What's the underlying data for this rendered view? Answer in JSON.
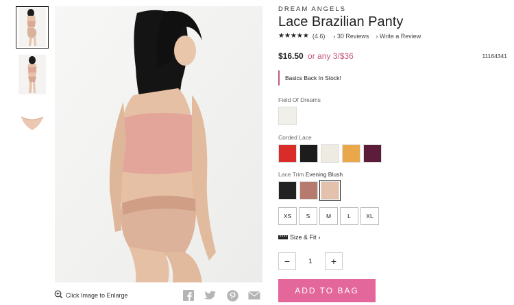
{
  "product": {
    "brand": "DREAM ANGELS",
    "title": "Lace Brazilian Panty",
    "stars": "★★★★★",
    "rating_count": "(4.6)",
    "reviews_link": "30 Reviews",
    "write_review": "Write a Review",
    "price": "$16.50",
    "promo": "or any 3/$36",
    "sku": "11164341",
    "notice": "Basics Back In Stock!"
  },
  "swatch_groups": [
    {
      "label": "Field Of Dreams",
      "selected_name": "",
      "colors": [
        "#f1efe9"
      ]
    },
    {
      "label": "Corded Lace",
      "selected_name": "",
      "colors": [
        "#d92b27",
        "#1c1c1c",
        "#eeece2",
        "#e9a84a",
        "#5c1c3a"
      ]
    },
    {
      "label": "Lace Trim",
      "selected_name": "Evening Blush",
      "colors": [
        "#222222",
        "#b77a6f",
        "#e3c1ac"
      ]
    }
  ],
  "sizes": [
    "XS",
    "S",
    "M",
    "L",
    "XL"
  ],
  "size_fit": "Size & Fit",
  "quantity": {
    "value": "1",
    "minus": "−",
    "plus": "+"
  },
  "add_to_bag": "ADD TO BAG",
  "enlarge_text": "Click Image to Enlarge",
  "colors": {
    "accent": "#e3679a",
    "promo": "#c45581"
  }
}
